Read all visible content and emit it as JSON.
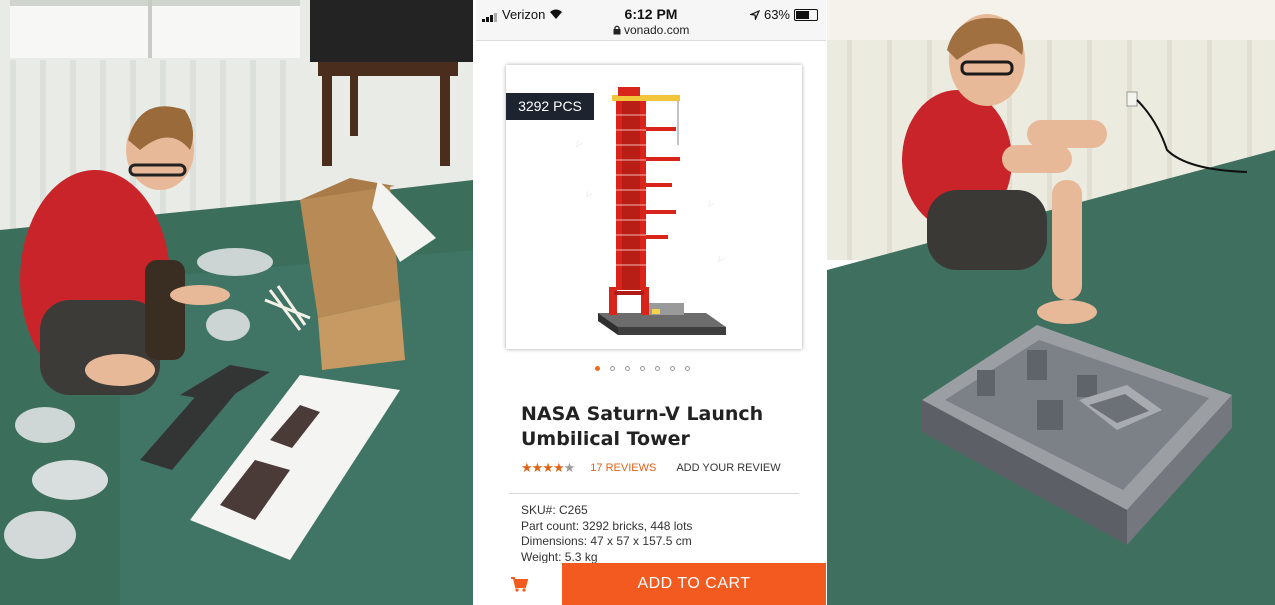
{
  "status_bar": {
    "carrier": "Verizon",
    "time": "6:12 PM",
    "battery": "63%",
    "url": "vonado.com"
  },
  "product": {
    "badge": "3292 PCS",
    "title": "NASA Saturn-V Launch Umbilical Tower",
    "rating": 4.5,
    "rating_max": 5,
    "reviews": "17  REVIEWS",
    "add_review": "ADD YOUR REVIEW",
    "specs": [
      "SKU#:  C265",
      "Part count: 3292 bricks, 448 lots",
      "Dimensions: 47 x 57 x 157.5 cm",
      "Weight: 5.3 kg"
    ],
    "image_count": 7,
    "active_image": 0
  },
  "cart": {
    "add_to_cart": "ADD TO CART"
  },
  "colors": {
    "accent": "#f25a1f",
    "badge_bg": "#1d2430",
    "tower_red": "#d9241b"
  }
}
